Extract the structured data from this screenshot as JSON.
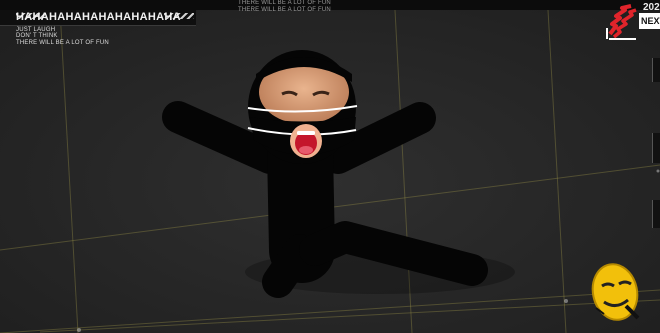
{
  "header": {
    "title": "HAHAHAHAHAHAHAHAHAHA",
    "caption_lines": [
      "JUST LAUGH",
      "DON' T THINK",
      "THERE WILL BE A LOT OF FUN"
    ],
    "ghost_lines": [
      "THERE WILL BE A LOT OF FUN",
      "THERE WILL BE A LOT OF FUN"
    ],
    "year": "202",
    "next_label": "NEXT"
  },
  "colors": {
    "background": "#2a2a2a",
    "figure": "#050505",
    "accent_red": "#e0242b",
    "accent_yellow": "#f2c00b",
    "grid_line": "#a39a4a"
  },
  "icons": {
    "top_right": "red-scribble-sticker-icon",
    "bottom_right": "yellow-mask-icon"
  }
}
